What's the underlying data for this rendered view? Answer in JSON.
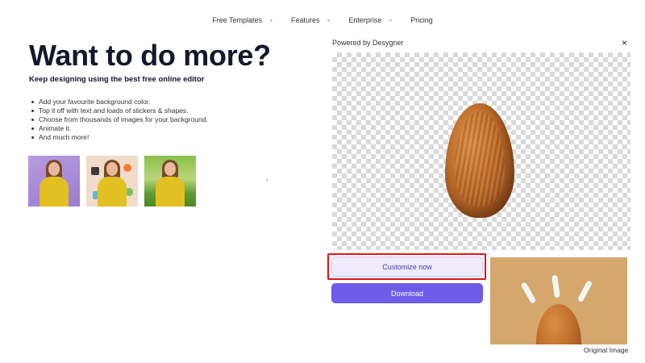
{
  "nav": {
    "items": [
      {
        "label": "Free Templates",
        "chevron": "⌄"
      },
      {
        "label": "Features",
        "chevron": "⌄"
      },
      {
        "label": "Enterprise",
        "chevron": "⌄"
      },
      {
        "label": "Pricing",
        "chevron": ""
      }
    ]
  },
  "hero": {
    "title": "Want to do more?",
    "subtitle": "Keep designing using the best free online editor",
    "features": [
      "Add your favourite background color.",
      "Top it off with text and loads of stickers & shapes.",
      "Choose from thousands of images for your background.",
      "Animate it.",
      "And much more!"
    ]
  },
  "panel": {
    "powered_by": "Powered by Desygner",
    "close_symbol": "×",
    "customize_label": "Customize now",
    "download_label": "Download",
    "original_label": "Original Image"
  },
  "colors": {
    "accent": "#6c5ce7",
    "customize_bg": "#efeafc",
    "highlight": "#e0141e",
    "original_bg": "#d5a76d"
  }
}
